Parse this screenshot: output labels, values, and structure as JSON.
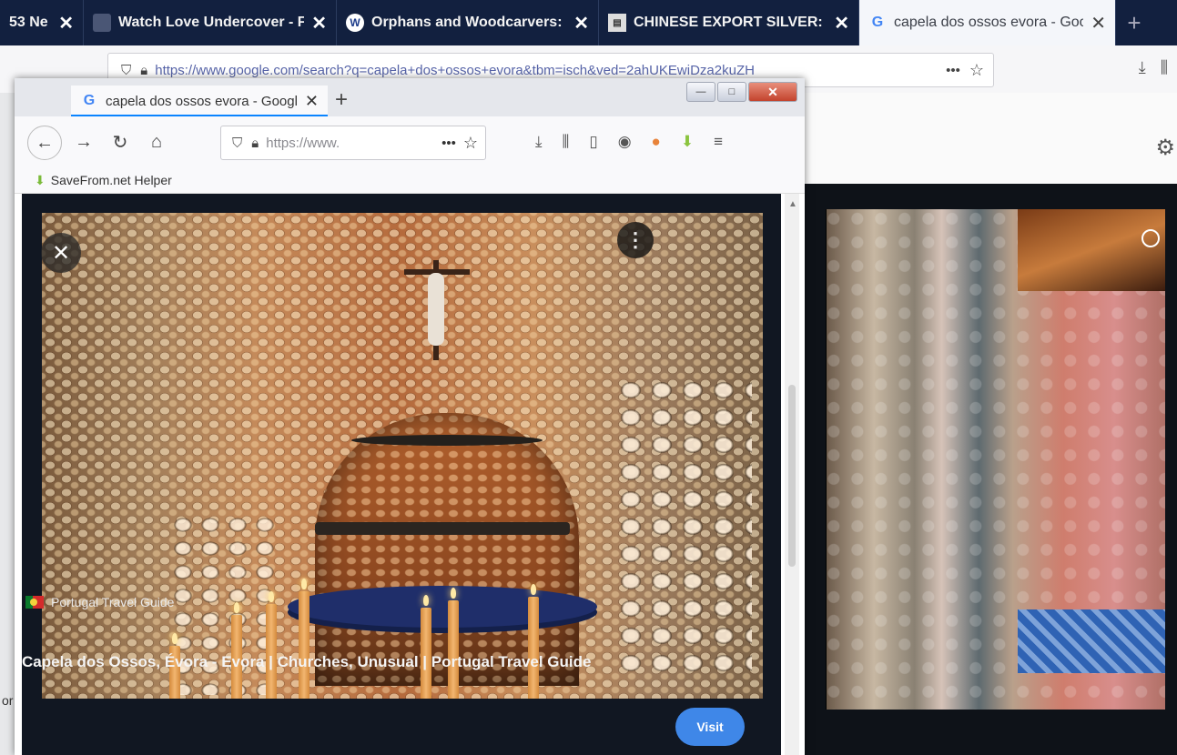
{
  "back_browser": {
    "tabs": [
      {
        "label": "53 Ne",
        "favicon": "none"
      },
      {
        "label": "Watch Love Undercover - Fsha",
        "favicon": "dark-square-icon"
      },
      {
        "label": "Orphans and Woodcarvers: Sh",
        "favicon": "wordpress-icon"
      },
      {
        "label": "CHINESE EXPORT SILVER: THE",
        "favicon": "book-icon"
      },
      {
        "label": "capela dos ossos evora - Googl",
        "favicon": "google-icon",
        "active": true
      }
    ],
    "close_glyph": "✕",
    "new_tab_glyph": "+",
    "url": "https://www.google.com/search?q=capela+dos+ossos+evora&tbm=isch&ved=2ahUKEwiDza2kuZH",
    "left_edge_text": "or"
  },
  "front_window": {
    "tab_label": "capela dos ossos evora - Googl",
    "url": "https://www.",
    "bookmark": "SaveFrom.net Helper",
    "controls": {
      "minimize": "—",
      "maximize": "□",
      "close": "✕"
    }
  },
  "result": {
    "source": "Portugal Travel Guide",
    "title": "Capela dos Ossos, Évora - Evora | Churches, Unusual | Portugal Travel Guide",
    "visit_label": "Visit",
    "close_glyph": "✕",
    "info_glyph": "⋮"
  },
  "colors": {
    "tab_bar": "#12203f",
    "accent_blue": "#0a84ff",
    "visit_button": "#3f87e8",
    "panel_bg": "#111722"
  }
}
